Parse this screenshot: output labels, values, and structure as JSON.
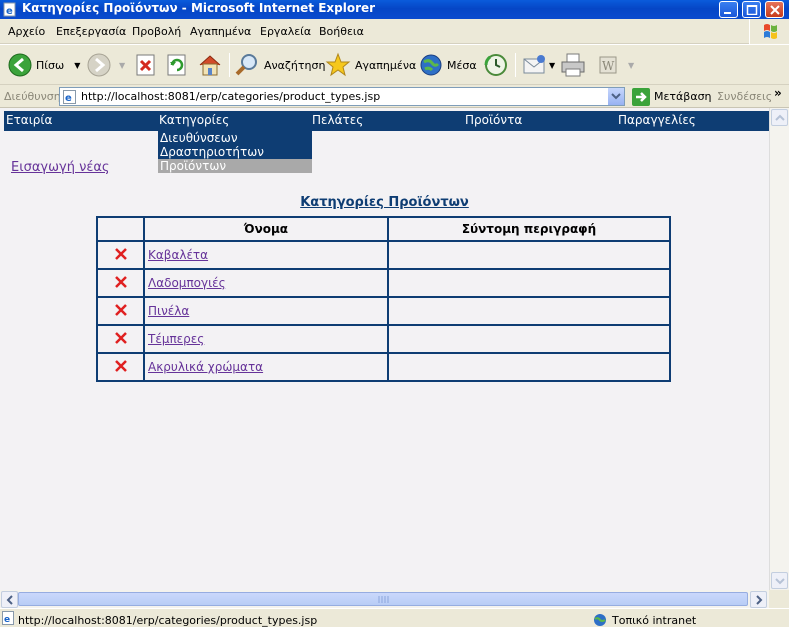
{
  "window": {
    "title": "Κατηγορίες Προϊόντων - Microsoft Internet Explorer"
  },
  "menu": [
    "Αρχείο",
    "Επεξεργασία",
    "Προβολή",
    "Αγαπημένα",
    "Εργαλεία",
    "Βοήθεια"
  ],
  "toolbar": {
    "back": "Πίσω",
    "search": "Αναζήτηση",
    "favorites": "Αγαπημένα",
    "media": "Μέσα"
  },
  "address": {
    "label": "Διεύθυνση",
    "url": "http://localhost:8081/erp/categories/product_types.jsp",
    "go": "Μετάβαση",
    "links": "Συνδέσεις"
  },
  "nav": [
    "Εταιρία",
    "Κατηγορίες",
    "Πελάτες",
    "Προϊόντα",
    "Παραγγελίες"
  ],
  "dropdown": [
    "Διευθύνσεων",
    "Δραστηριοτήτων",
    "Προϊόντων"
  ],
  "page": {
    "insert_link": "Εισαγωγή νέας",
    "table_title": "Κατηγορίες Προϊόντων",
    "columns": [
      "Όνομα",
      "Σύντομη περιγραφή"
    ],
    "rows": [
      {
        "name": "Καβαλέτα",
        "desc": ""
      },
      {
        "name": "Λαδομπογιές",
        "desc": ""
      },
      {
        "name": "Πινέλα",
        "desc": ""
      },
      {
        "name": "Τέμπερες",
        "desc": ""
      },
      {
        "name": "Ακρυλικά χρώματα",
        "desc": ""
      }
    ]
  },
  "status": {
    "text": "http://localhost:8081/erp/categories/product_types.jsp",
    "zone": "Τοπικό intranet"
  },
  "colors": {
    "nav_bg": "#0E3D73",
    "visited_link": "#663399",
    "delete_x": "#E02020"
  }
}
